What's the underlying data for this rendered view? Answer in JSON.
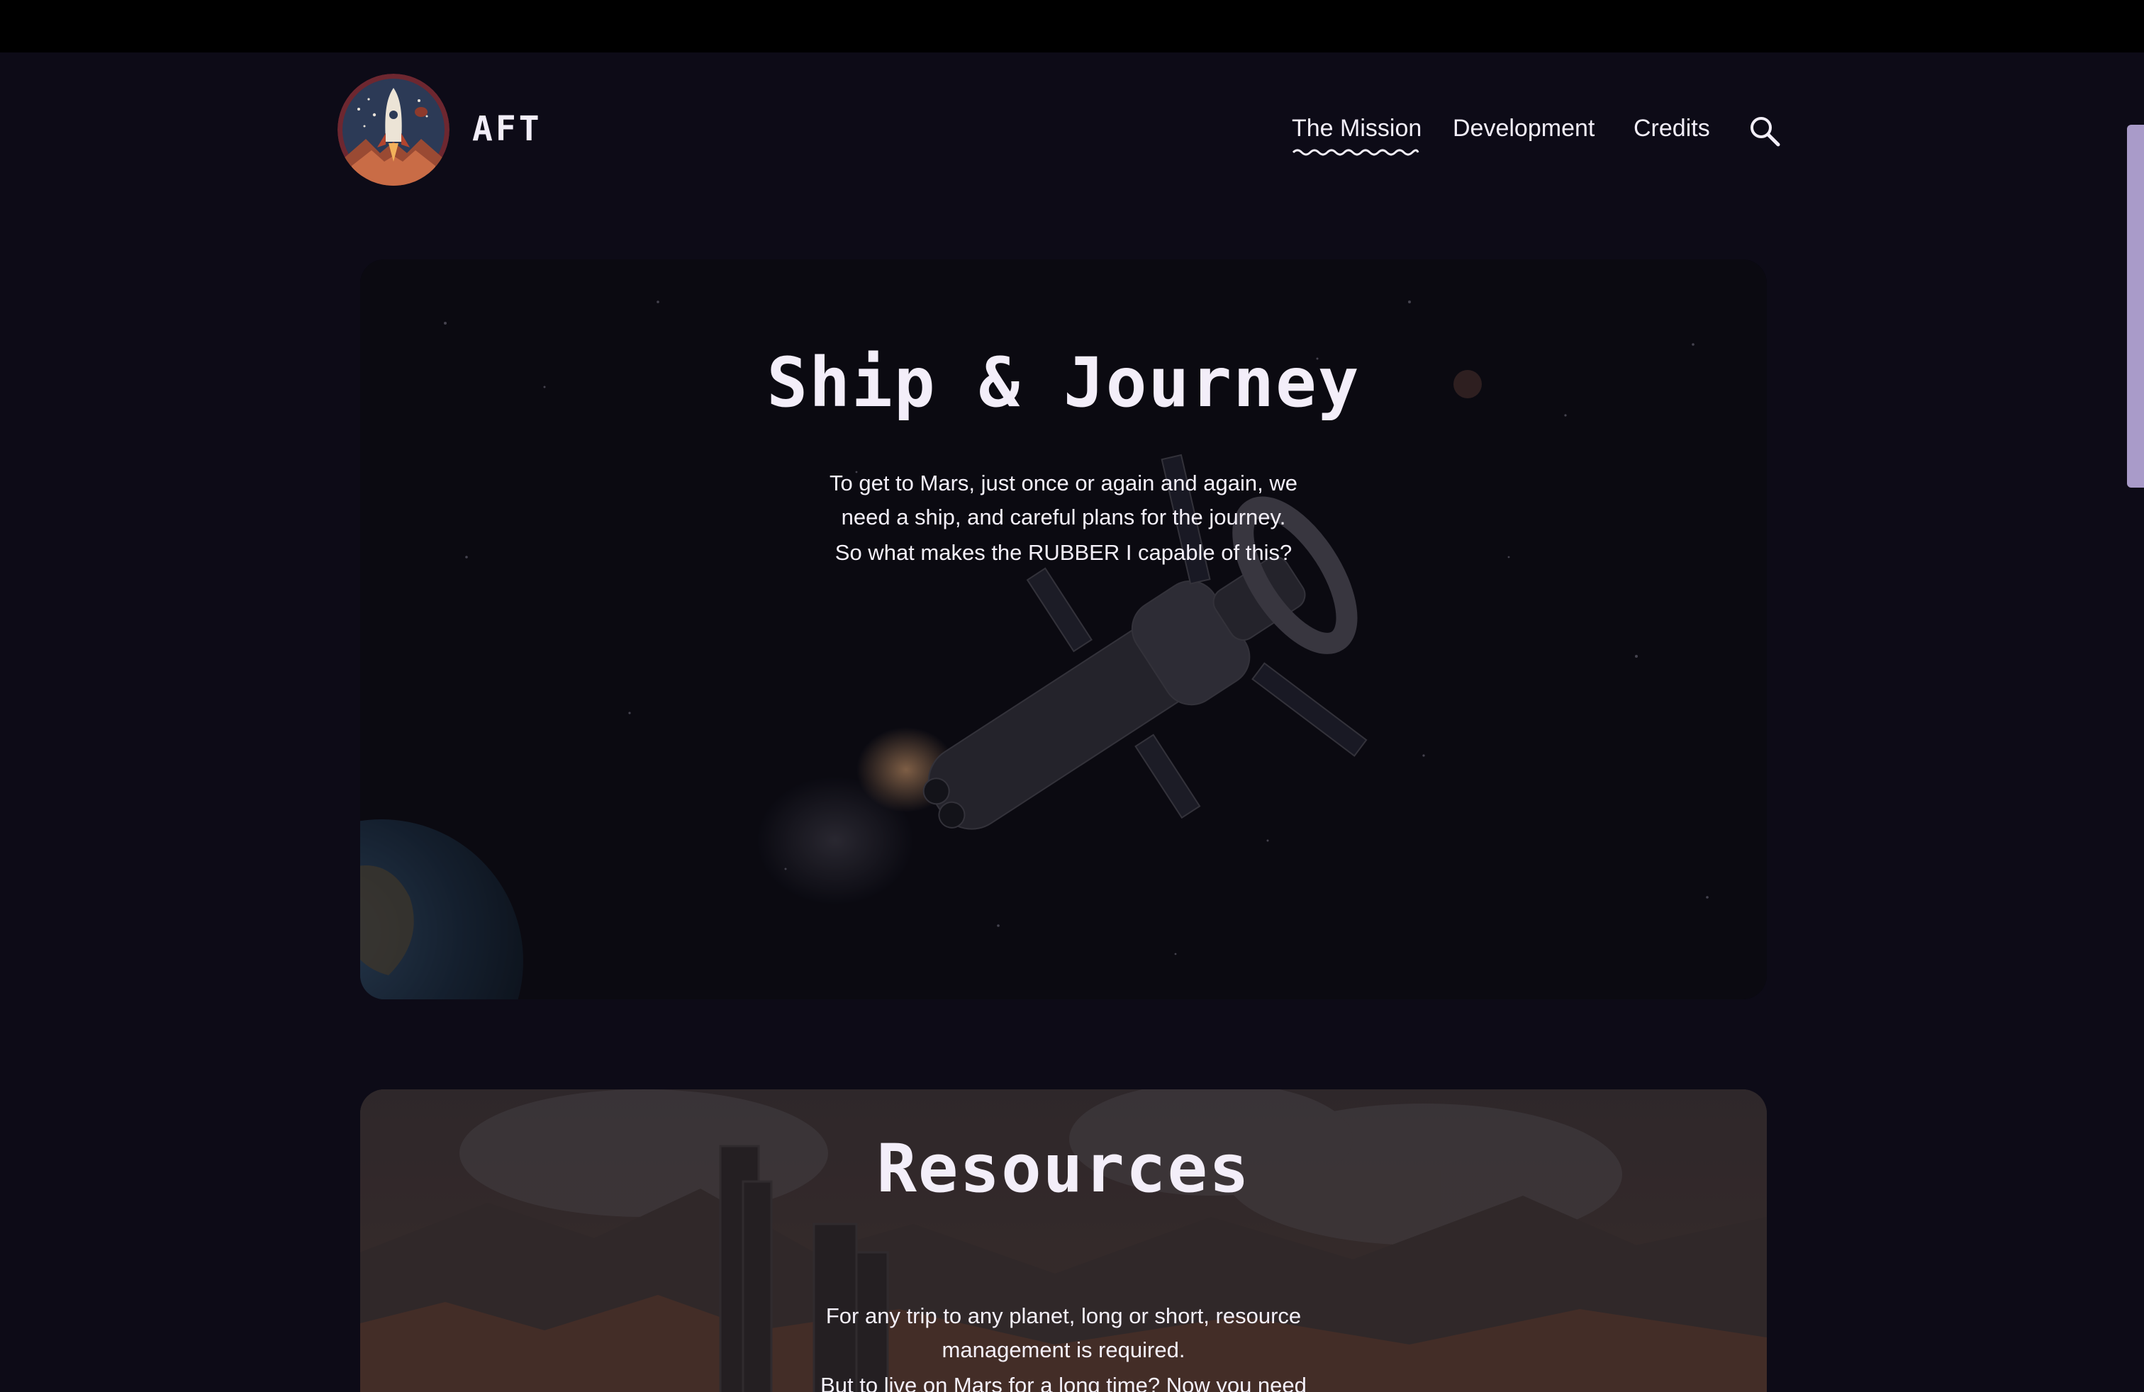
{
  "header": {
    "brand": "AFT",
    "nav": [
      {
        "label": "The Mission",
        "active": true
      },
      {
        "label": "Development"
      },
      {
        "label": "Credits"
      }
    ],
    "search_icon": "search-icon"
  },
  "sections": {
    "ship": {
      "title": "Ship & Journey",
      "line1": "To get to Mars, just once or again and again, we",
      "line2": "need a ship, and careful plans for the journey.",
      "line3": "So what makes the RUBBER I capable of this?"
    },
    "resources": {
      "title": "Resources",
      "line1": "For any trip to any planet, long or short, resource",
      "line2": "management is required.",
      "line3": "But to live on Mars for a long time? Now you need"
    }
  },
  "colors": {
    "background": "#0d0b17",
    "accent_scrollbar": "#a99bc9",
    "logo_ring": "#7a2b2b",
    "logo_bg": "#2d3b55"
  }
}
